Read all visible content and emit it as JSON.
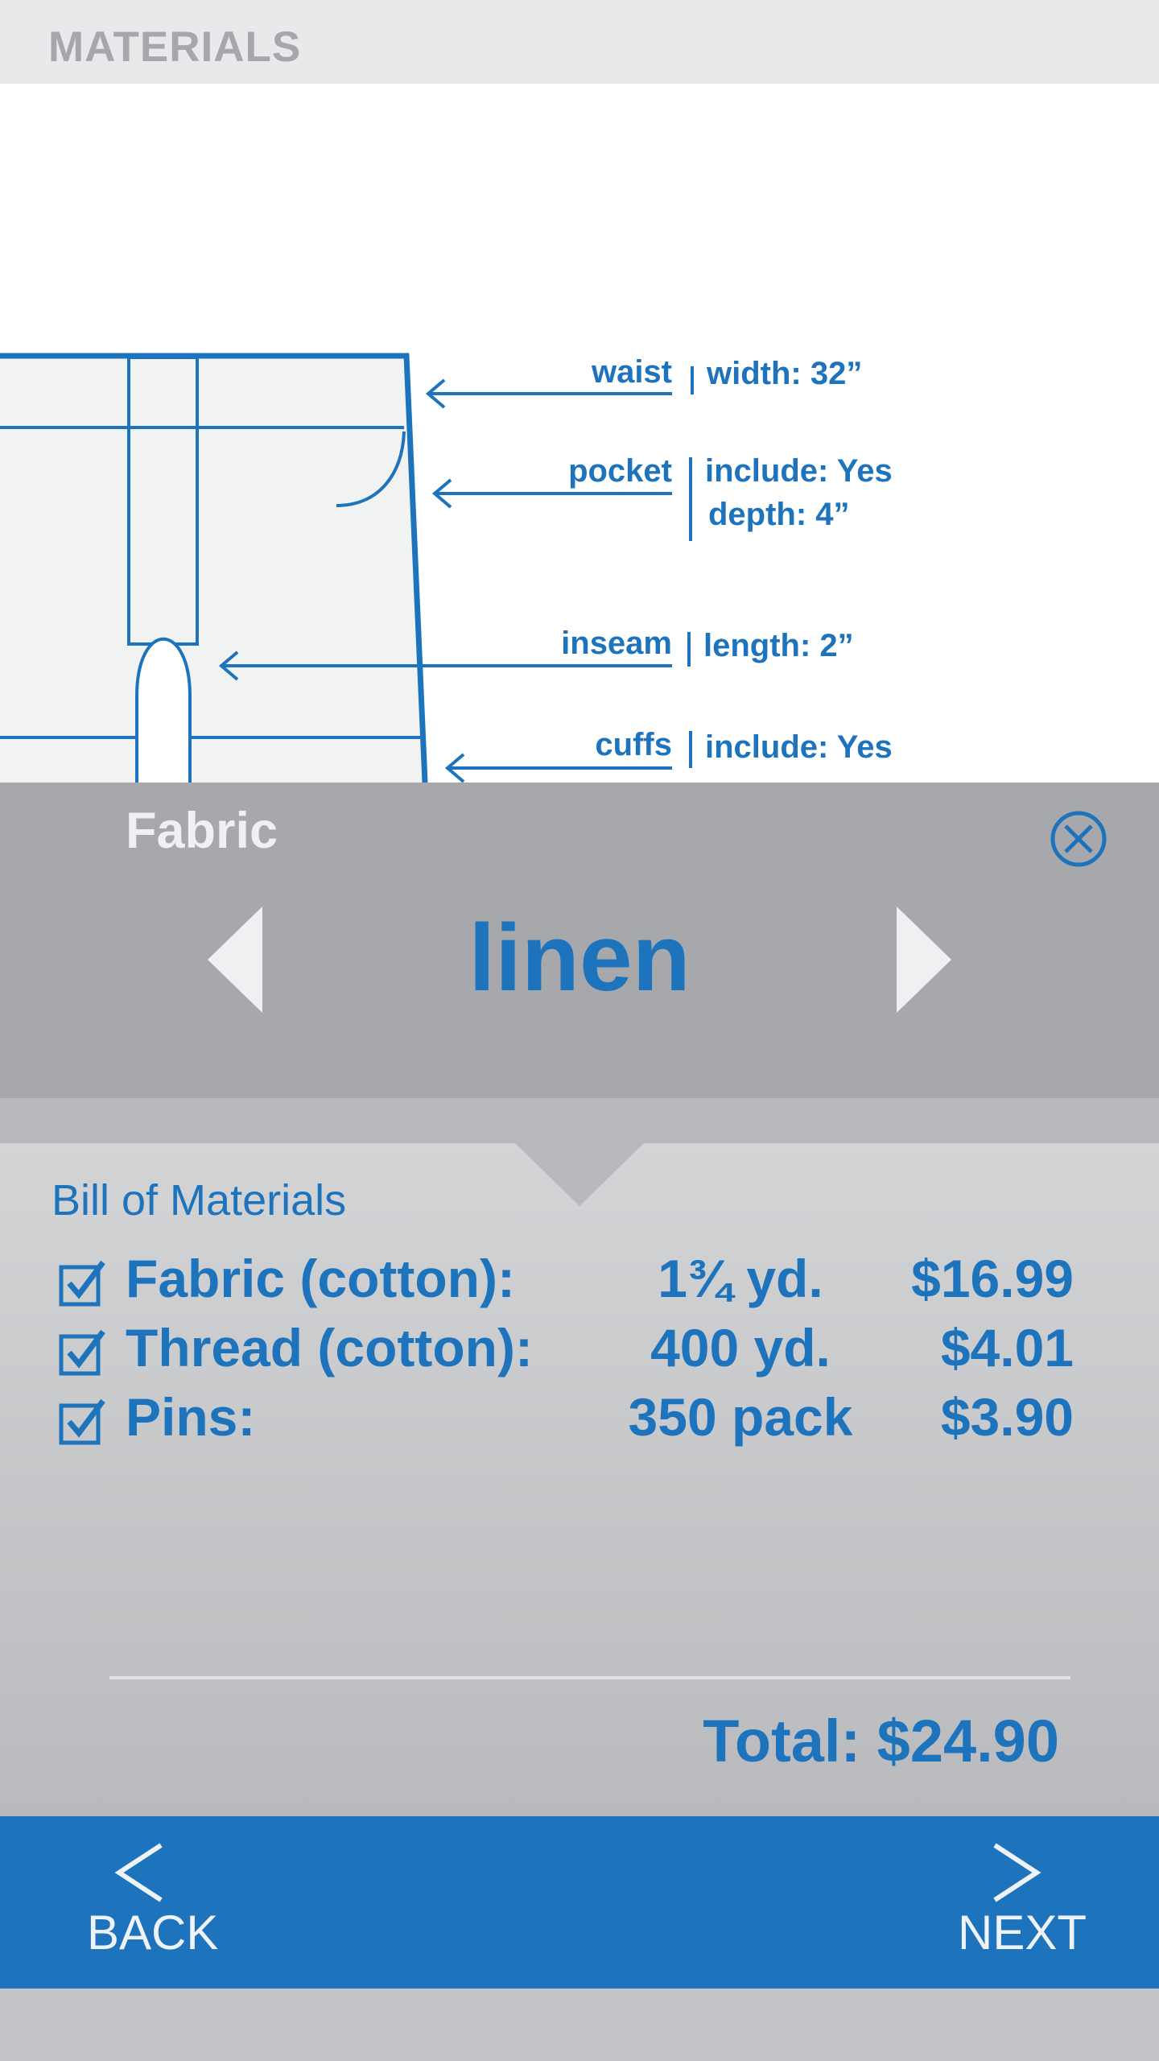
{
  "header": {
    "title": "MATERIALS"
  },
  "diagram": {
    "callouts": [
      {
        "part": "waist",
        "details": [
          "width: 32”"
        ]
      },
      {
        "part": "pocket",
        "details": [
          "include: Yes",
          "depth: 4”"
        ]
      },
      {
        "part": "inseam",
        "details": [
          "length: 2”"
        ]
      },
      {
        "part": "cuffs",
        "details": [
          "include: Yes"
        ]
      }
    ]
  },
  "fabric_selector": {
    "label": "Fabric",
    "value": "linen"
  },
  "bill_of_materials": {
    "title": "Bill of Materials",
    "items": [
      {
        "name": "Fabric (cotton):",
        "quantity": "1¾ yd.",
        "price": "$16.99",
        "checked": true
      },
      {
        "name": "Thread (cotton):",
        "quantity": "400 yd.",
        "price": "$4.01",
        "checked": true
      },
      {
        "name": "Pins:",
        "quantity": "350 pack",
        "price": "$3.90",
        "checked": true
      }
    ],
    "total": "Total: $24.90"
  },
  "footer": {
    "back_label": "BACK",
    "next_label": "NEXT"
  },
  "colors": {
    "accent": "#1e73bd",
    "panel_gray": "#a7a8ab",
    "header_text": "#a6a7aa"
  }
}
